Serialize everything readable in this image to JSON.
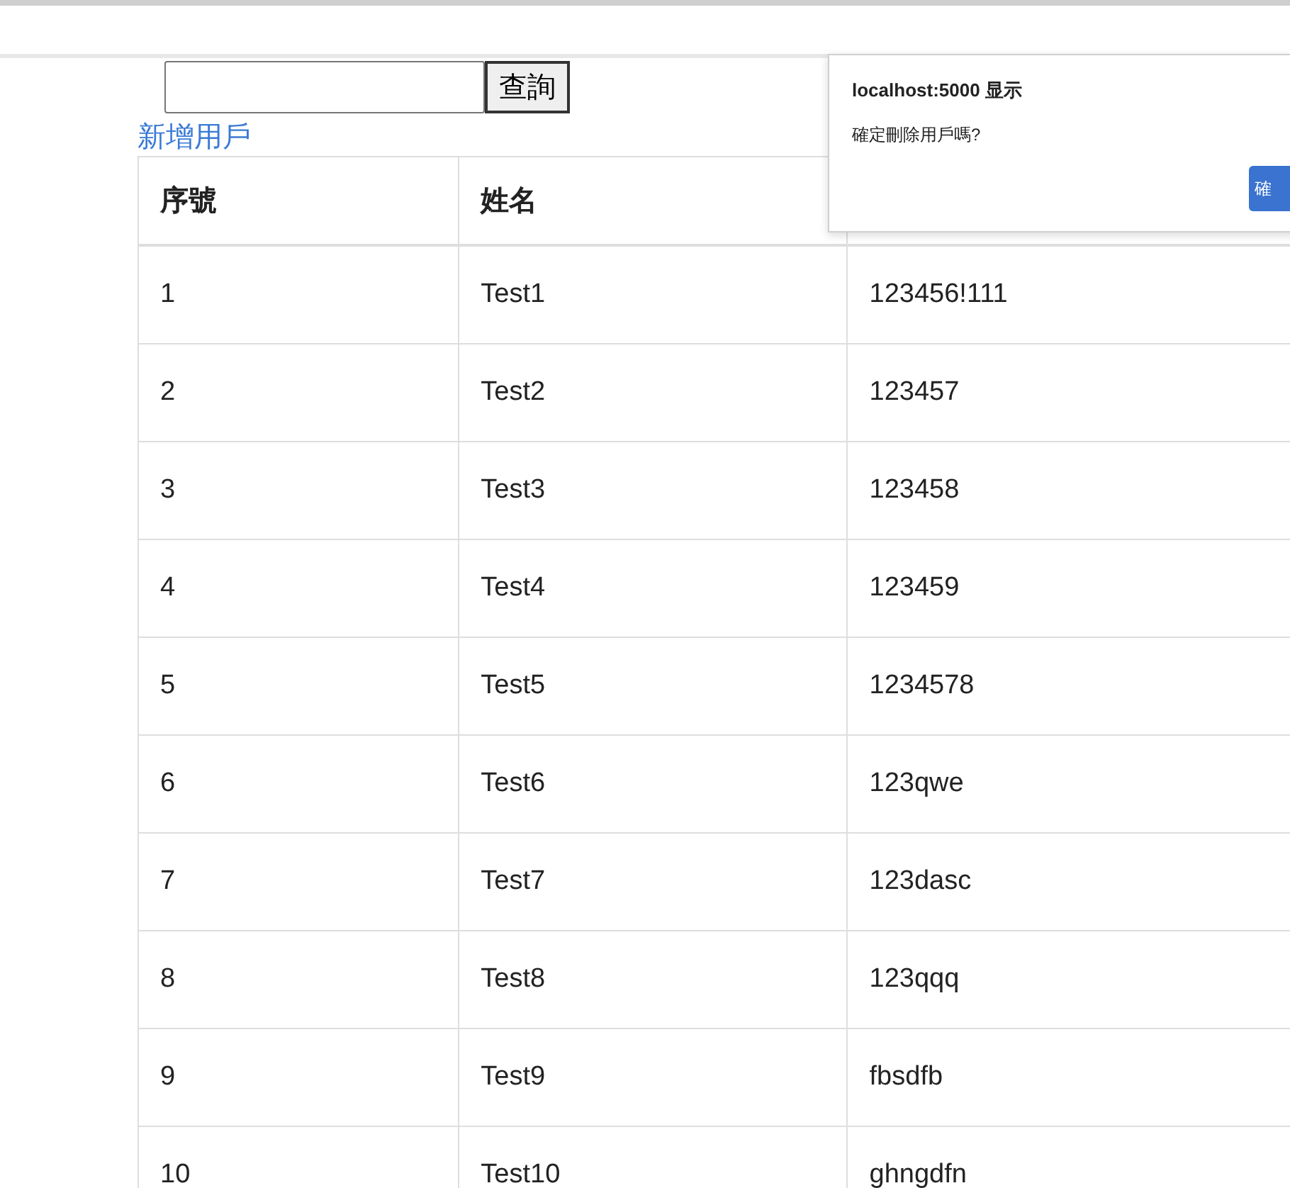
{
  "search": {
    "button": "查詢"
  },
  "add_link": "新增用戶",
  "table": {
    "columns": [
      "序號",
      "姓名"
    ],
    "rows": [
      [
        "1",
        "Test1",
        "123456!111"
      ],
      [
        "2",
        "Test2",
        "123457"
      ],
      [
        "3",
        "Test3",
        "123458"
      ],
      [
        "4",
        "Test4",
        "123459"
      ],
      [
        "5",
        "Test5",
        "1234578"
      ],
      [
        "6",
        "Test6",
        "123qwe"
      ],
      [
        "7",
        "Test7",
        "123dasc"
      ],
      [
        "8",
        "Test8",
        "123qqq"
      ],
      [
        "9",
        "Test9",
        "fbsdfb"
      ],
      [
        "10",
        "Test10",
        "ghngdfn"
      ]
    ]
  },
  "dialog": {
    "title": "localhost:5000 显示",
    "message": "確定刪除用戶嗎?",
    "button": "確"
  }
}
